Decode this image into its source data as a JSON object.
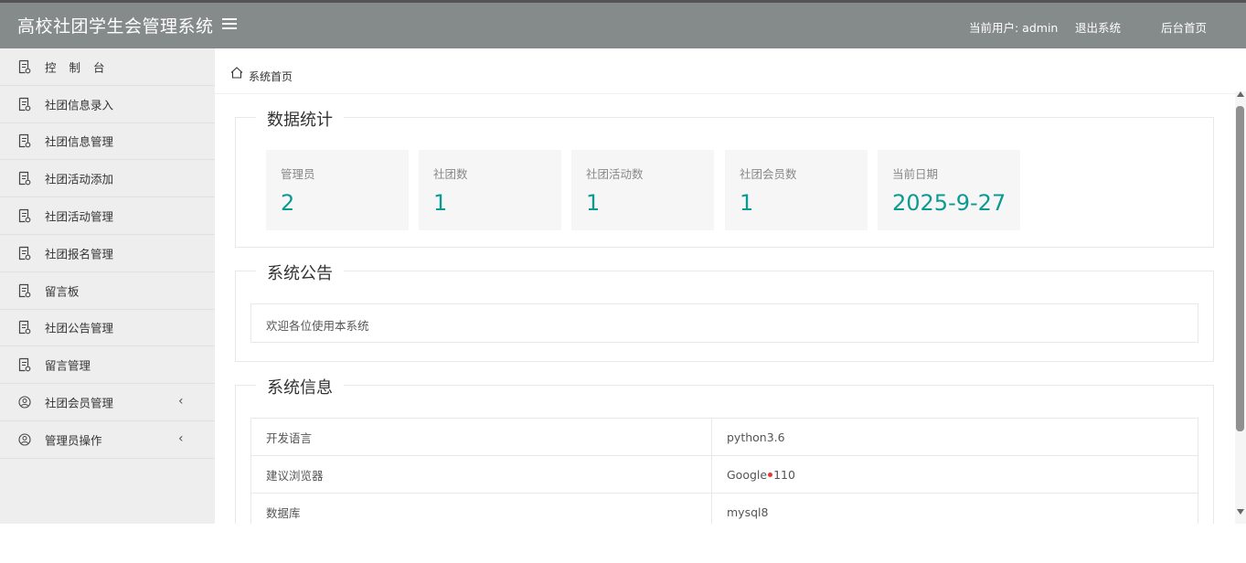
{
  "header": {
    "title": "高校社团学生会管理系统",
    "current_user": "当前用户: admin",
    "logout": "退出系统",
    "backend_home": "后台首页"
  },
  "sidebar": {
    "items": [
      {
        "label": "控制台",
        "icon": "document-icon"
      },
      {
        "label": "社团信息录入",
        "icon": "document-icon"
      },
      {
        "label": "社团信息管理",
        "icon": "document-icon"
      },
      {
        "label": "社团活动添加",
        "icon": "document-icon"
      },
      {
        "label": "社团活动管理",
        "icon": "document-icon"
      },
      {
        "label": "社团报名管理",
        "icon": "document-icon"
      },
      {
        "label": "留言板",
        "icon": "document-icon"
      },
      {
        "label": "社团公告管理",
        "icon": "document-icon"
      },
      {
        "label": "留言管理",
        "icon": "document-icon"
      },
      {
        "label": "社团会员管理",
        "icon": "user-circle-icon",
        "expandable": true
      },
      {
        "label": "管理员操作",
        "icon": "user-circle-icon",
        "expandable": true
      }
    ]
  },
  "breadcrumb": {
    "label": "系统首页",
    "icon": "home-icon"
  },
  "stats": {
    "title": "数据统计",
    "cards": [
      {
        "label": "管理员",
        "value": "2"
      },
      {
        "label": "社团数",
        "value": "1"
      },
      {
        "label": "社团活动数",
        "value": "1"
      },
      {
        "label": "社团会员数",
        "value": "1"
      },
      {
        "label": "当前日期",
        "value": "2025-9-27"
      }
    ]
  },
  "notice": {
    "title": "系统公告",
    "text": "欢迎各位使用本系统"
  },
  "sysinfo": {
    "title": "系统信息",
    "rows": [
      {
        "key": "开发语言",
        "value": "python3.6"
      },
      {
        "key": "建议浏览器",
        "value_pre": "Google",
        "value_post": "110"
      },
      {
        "key": "数据库",
        "value": "mysql8"
      }
    ]
  },
  "colors": {
    "header_bg": "#858a8a",
    "sidebar_bg": "#eeeeee",
    "accent": "#0b9a91"
  }
}
